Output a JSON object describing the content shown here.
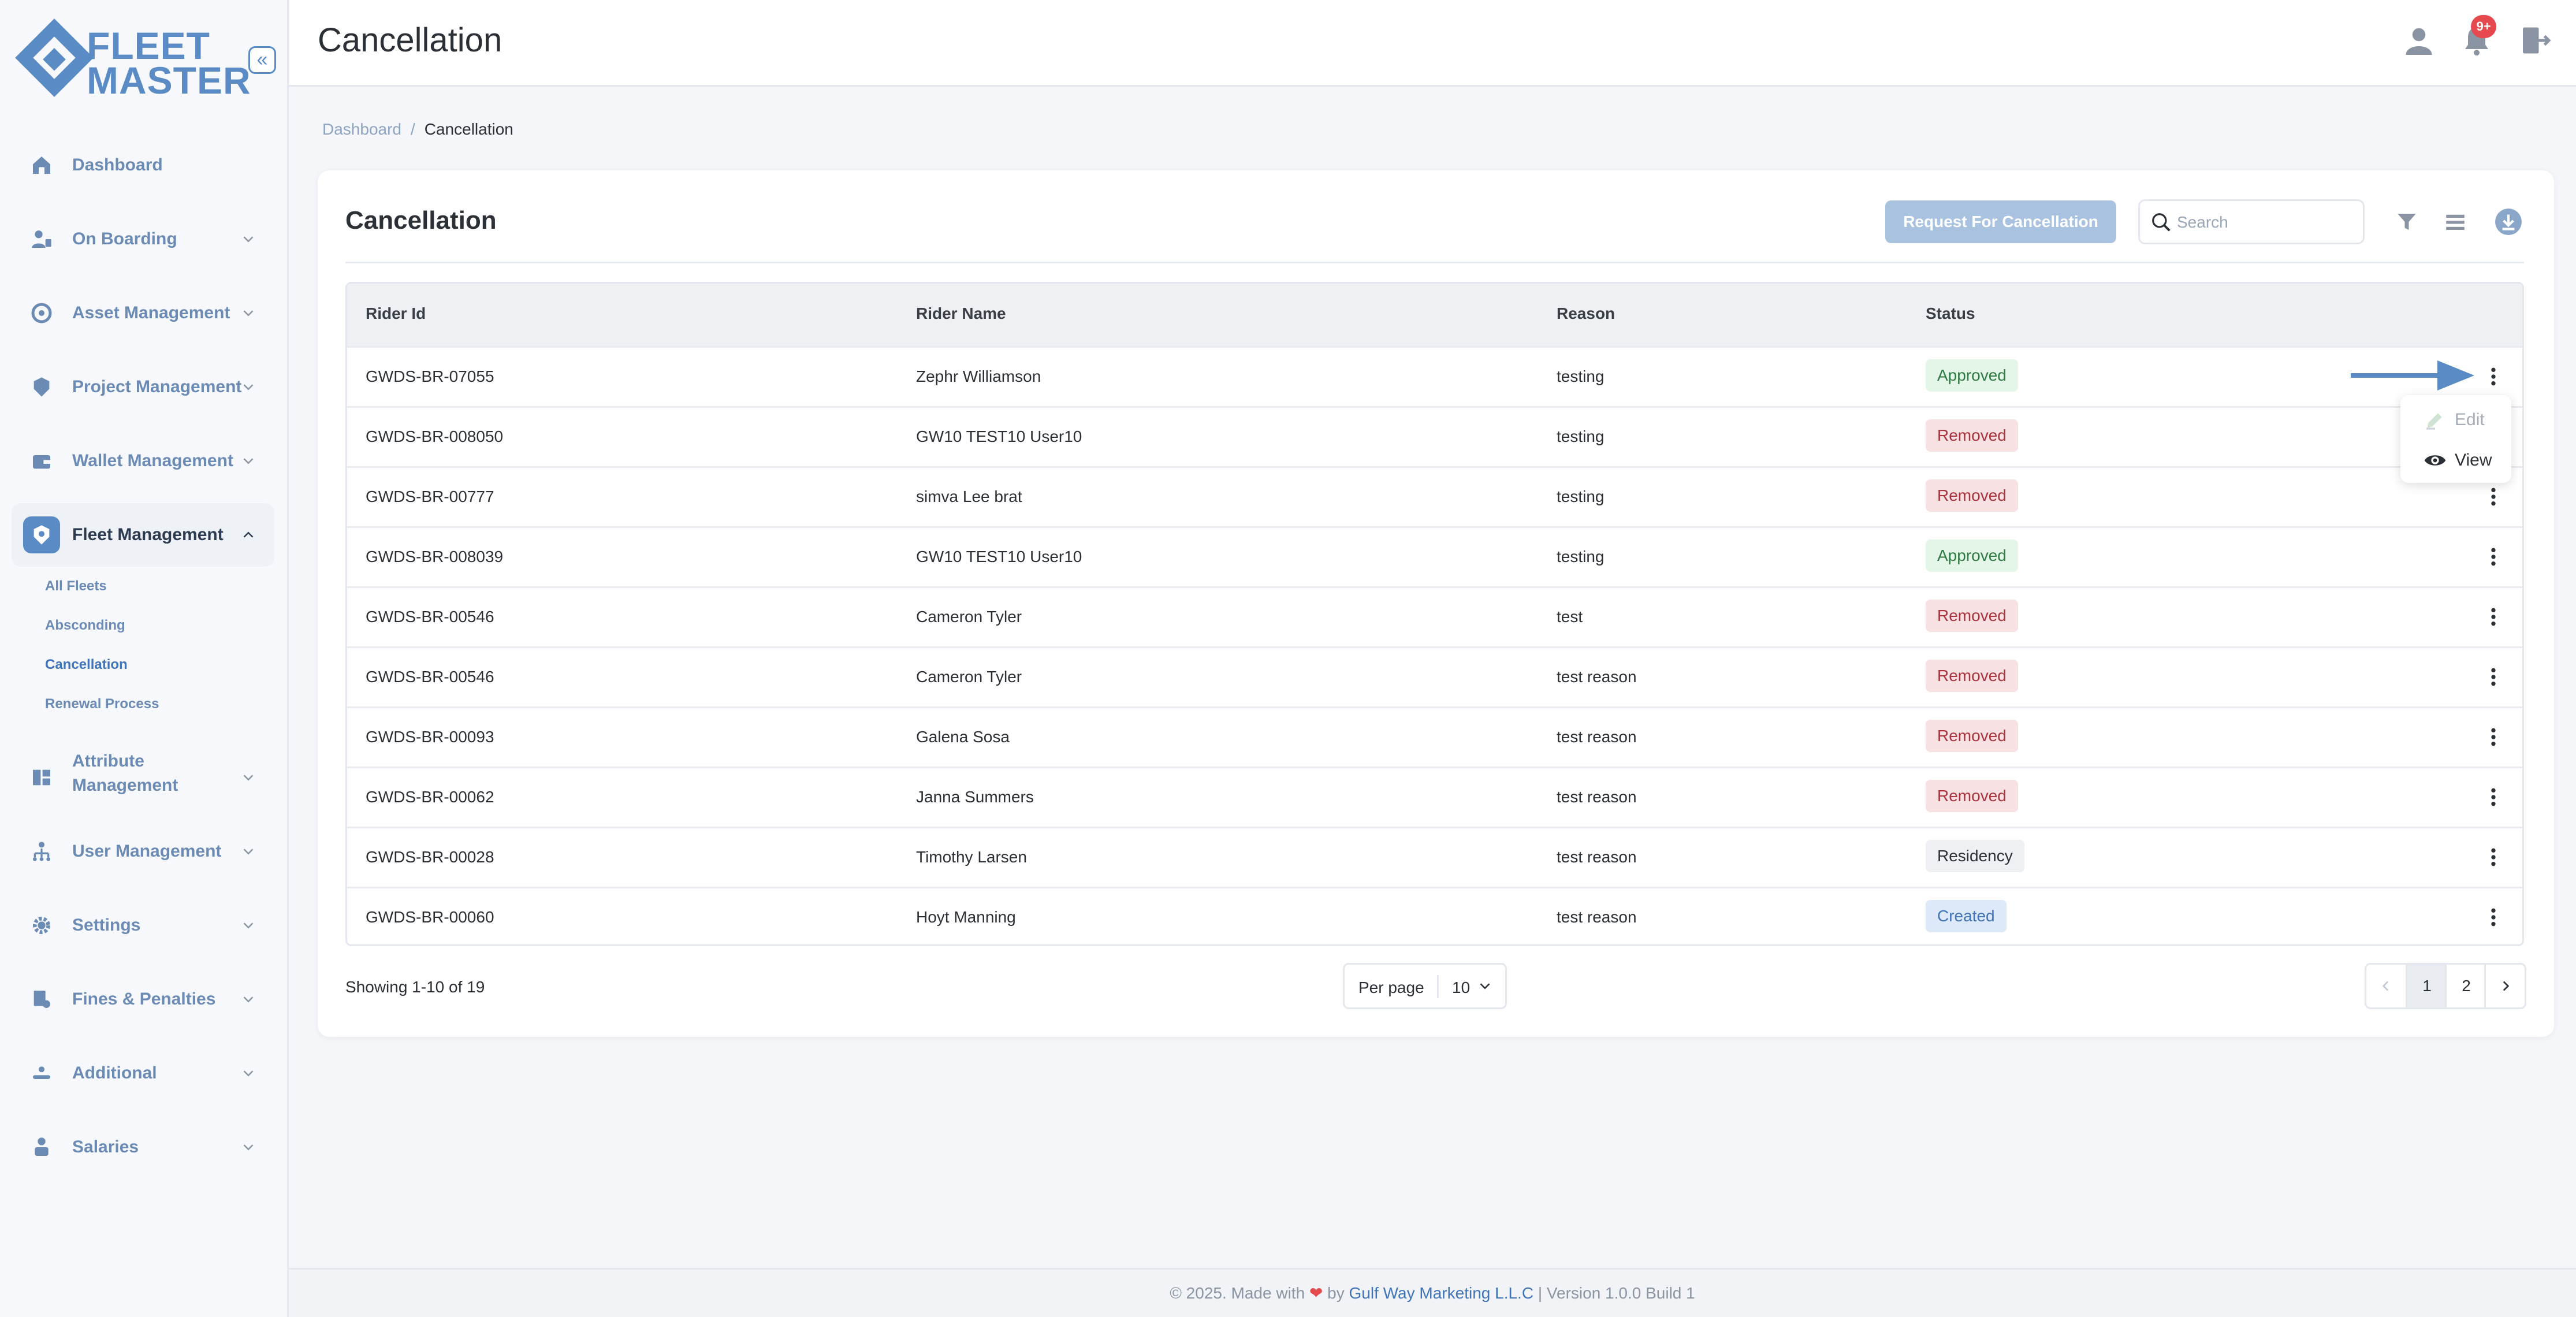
{
  "app": {
    "logo_line1": "FLEET",
    "logo_line2": "MASTER"
  },
  "sidebar": {
    "items": [
      {
        "label": "Dashboard",
        "icon": "home-icon"
      },
      {
        "label": "On Boarding",
        "icon": "onboarding-icon"
      },
      {
        "label": "Asset Management",
        "icon": "asset-icon"
      },
      {
        "label": "Project Management",
        "icon": "project-icon"
      },
      {
        "label": "Wallet Management",
        "icon": "wallet-icon"
      },
      {
        "label": "Fleet Management",
        "icon": "fleet-icon",
        "active": true
      },
      {
        "label": "Attribute Management",
        "label_line1": "Attribute",
        "label_line2": "Management",
        "icon": "attribute-icon"
      },
      {
        "label": "User Management",
        "icon": "user-management-icon"
      },
      {
        "label": "Settings",
        "icon": "gear-icon"
      },
      {
        "label": "Fines & Penalties",
        "icon": "fines-icon"
      },
      {
        "label": "Additional",
        "icon": "additional-icon"
      },
      {
        "label": "Salaries",
        "icon": "salaries-icon"
      }
    ],
    "fleet_submenu": [
      "All Fleets",
      "Absconding",
      "Cancellation",
      "Renewal Process"
    ]
  },
  "header": {
    "title": "Cancellation",
    "notification_count": "9+"
  },
  "breadcrumb": {
    "home": "Dashboard",
    "separator": "/",
    "current": "Cancellation"
  },
  "card": {
    "title": "Cancellation",
    "request_button": "Request For Cancellation",
    "search_placeholder": "Search"
  },
  "table": {
    "columns": [
      "Rider Id",
      "Rider Name",
      "Reason",
      "Status"
    ],
    "rows": [
      {
        "rider_id": "GWDS-BR-07055",
        "rider_name": "Zephr Williamson",
        "reason": "testing",
        "status": "Approved"
      },
      {
        "rider_id": "GWDS-BR-008050",
        "rider_name": "GW10 TEST10 User10",
        "reason": "testing",
        "status": "Removed"
      },
      {
        "rider_id": "GWDS-BR-00777",
        "rider_name": "simva Lee brat",
        "reason": "testing",
        "status": "Removed"
      },
      {
        "rider_id": "GWDS-BR-008039",
        "rider_name": "GW10 TEST10 User10",
        "reason": "testing",
        "status": "Approved"
      },
      {
        "rider_id": "GWDS-BR-00546",
        "rider_name": "Cameron Tyler",
        "reason": "test",
        "status": "Removed"
      },
      {
        "rider_id": "GWDS-BR-00546",
        "rider_name": "Cameron Tyler",
        "reason": "test reason",
        "status": "Removed"
      },
      {
        "rider_id": "GWDS-BR-00093",
        "rider_name": "Galena Sosa",
        "reason": "test reason",
        "status": "Removed"
      },
      {
        "rider_id": "GWDS-BR-00062",
        "rider_name": "Janna Summers",
        "reason": "test reason",
        "status": "Removed"
      },
      {
        "rider_id": "GWDS-BR-00028",
        "rider_name": "Timothy Larsen",
        "reason": "test reason",
        "status": "Residency"
      },
      {
        "rider_id": "GWDS-BR-00060",
        "rider_name": "Hoyt Manning",
        "reason": "test reason",
        "status": "Created"
      }
    ]
  },
  "row_menu": {
    "edit": "Edit",
    "view": "View"
  },
  "pagination": {
    "showing": "Showing 1-10 of 19",
    "per_page_label": "Per page",
    "per_page_value": "10",
    "pages": [
      "1",
      "2"
    ],
    "current_page": "1"
  },
  "footer": {
    "prefix": "© 2025. Made with",
    "by": "by",
    "company": "Gulf Way Marketing L.L.C",
    "version": "| Version 1.0.0 Build 1"
  },
  "colors": {
    "accent": "#5b8bc4",
    "approved": "#2f7a43",
    "removed": "#a7333d",
    "created": "#3f74b8"
  }
}
